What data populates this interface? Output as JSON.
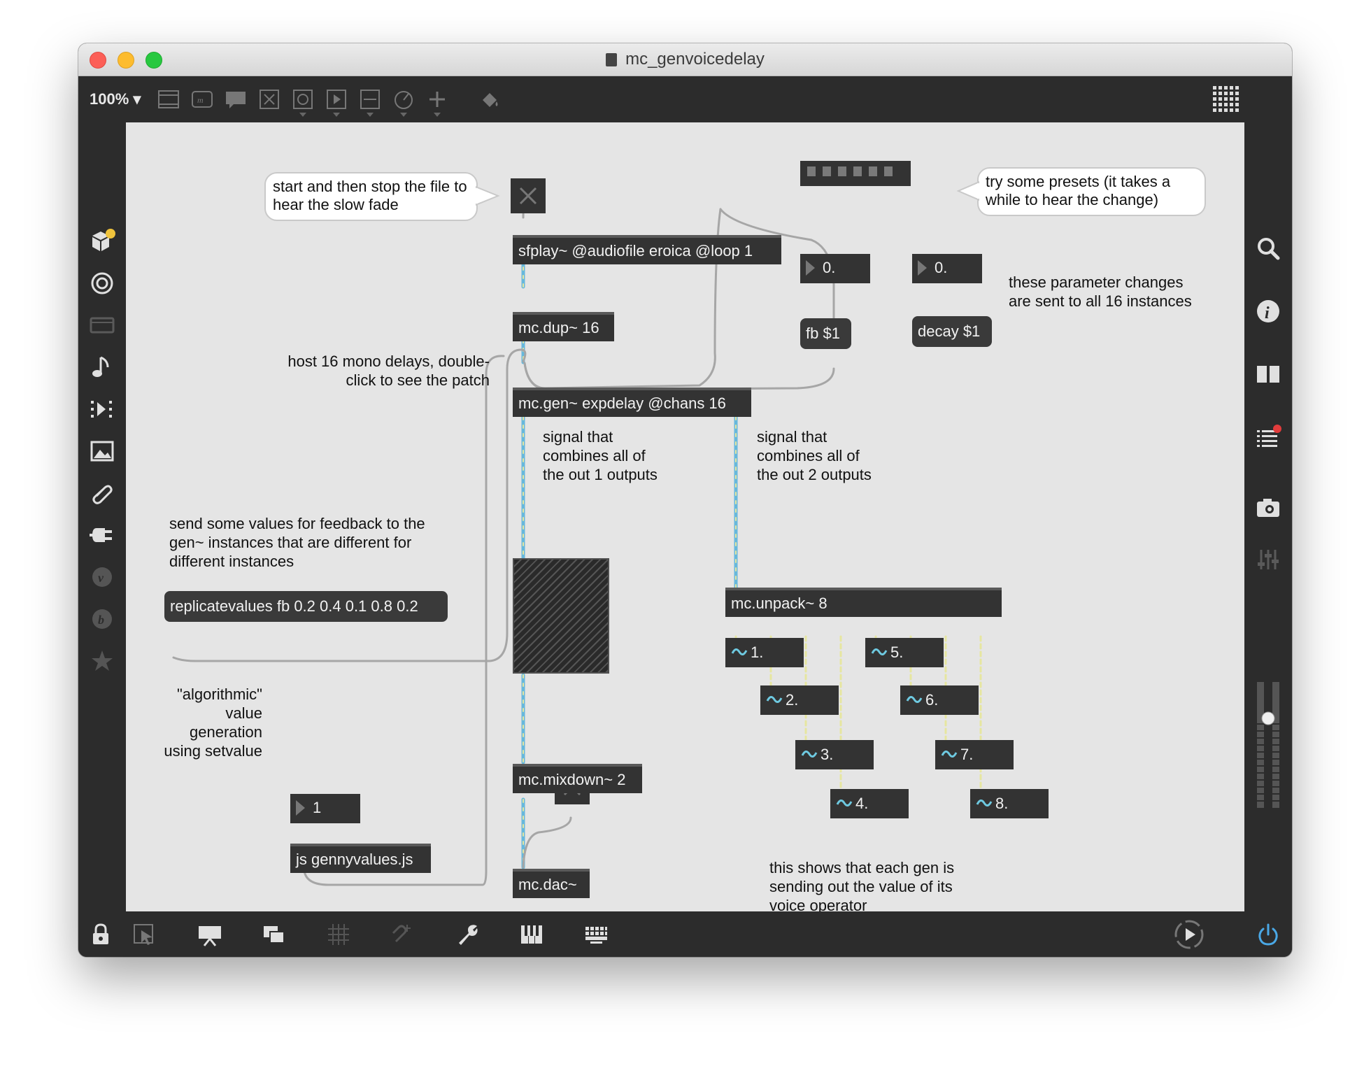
{
  "window": {
    "title": "mc_genvoicedelay",
    "traffic_lights": [
      "close",
      "minimize",
      "zoom"
    ]
  },
  "toolbar": {
    "zoom_label": "100% ▾",
    "icons": [
      "new-object-icon",
      "message-icon",
      "comment-icon",
      "toggle-icon",
      "button-icon",
      "playbar-icon",
      "slider-icon",
      "dial-icon",
      "add-icon",
      "paint-icon"
    ],
    "grid_icon": "grid-dots-icon"
  },
  "left_sidebar": {
    "icons": [
      "package-icon",
      "target-icon",
      "video-icon",
      "music-note-icon",
      "media-icon",
      "image-icon",
      "paperclip-icon",
      "plug-icon",
      "vizzie-icon",
      "beap-icon",
      "star-icon"
    ]
  },
  "right_sidebar": {
    "icons": [
      "search-icon",
      "info-icon",
      "columns-icon",
      "list-icon",
      "camera-icon",
      "mixer-icon"
    ],
    "list_badge_color": "#e23c3c",
    "meter_icon": "level-meter-icon"
  },
  "bottom_toolbar": {
    "icons": [
      "lock-icon",
      "presentation-arrow-icon",
      "present-icon",
      "layers-icon",
      "grid-icon",
      "snap-icon",
      "wrench-icon",
      "piano-keys-icon",
      "keyboard-icon",
      "transport-icon",
      "power-icon"
    ],
    "power_color": "#4aa8e6"
  },
  "patch": {
    "comments": {
      "start_stop": "start and then stop the file to hear the slow fade",
      "try_presets": "try some presets (it takes a while to hear the change)",
      "param_changes": "these parameter changes are sent to all 16 instances",
      "host_delays": "host 16 mono delays, double-click to see the patch",
      "signal_out1": "signal that combines all of the out 1 outputs",
      "signal_out2": "signal that combines all of the out 2 outputs",
      "send_values": "send some values for feedback to the gen~ instances that are different for different instances",
      "algorithmic": "\"algorithmic\" value generation using setvalue",
      "each_gen": "this shows that each gen is sending out the value of its voice operator"
    },
    "objects": {
      "sfplay": "sfplay~ @audiofile eroica @loop 1",
      "mcdup": "mc.dup~ 16",
      "mcgen": "mc.gen~ expdelay @chans 16",
      "mcunpack": "mc.unpack~ 8",
      "mcmixdown": "mc.mixdown~ 2",
      "mcdac": "mc.dac~",
      "jsgenny": "js gennyvalues.js"
    },
    "messages": {
      "fb": "fb $1",
      "decay": "decay $1",
      "replicate": "replicatevalues fb 0.2 0.4 0.1 0.8 0.2"
    },
    "number_boxes": {
      "fb_value": "0.",
      "decay_value": "0.",
      "int_value": "1"
    },
    "signal_numbers": [
      "1.",
      "2.",
      "3.",
      "4.",
      "5.",
      "6.",
      "7.",
      "8."
    ],
    "colors": {
      "signal_cable": "#67b8dc",
      "control_cable": "#a6a6a6",
      "signal_number_icon": "#6ec9e0",
      "inlet": "#e6e6a0"
    }
  }
}
